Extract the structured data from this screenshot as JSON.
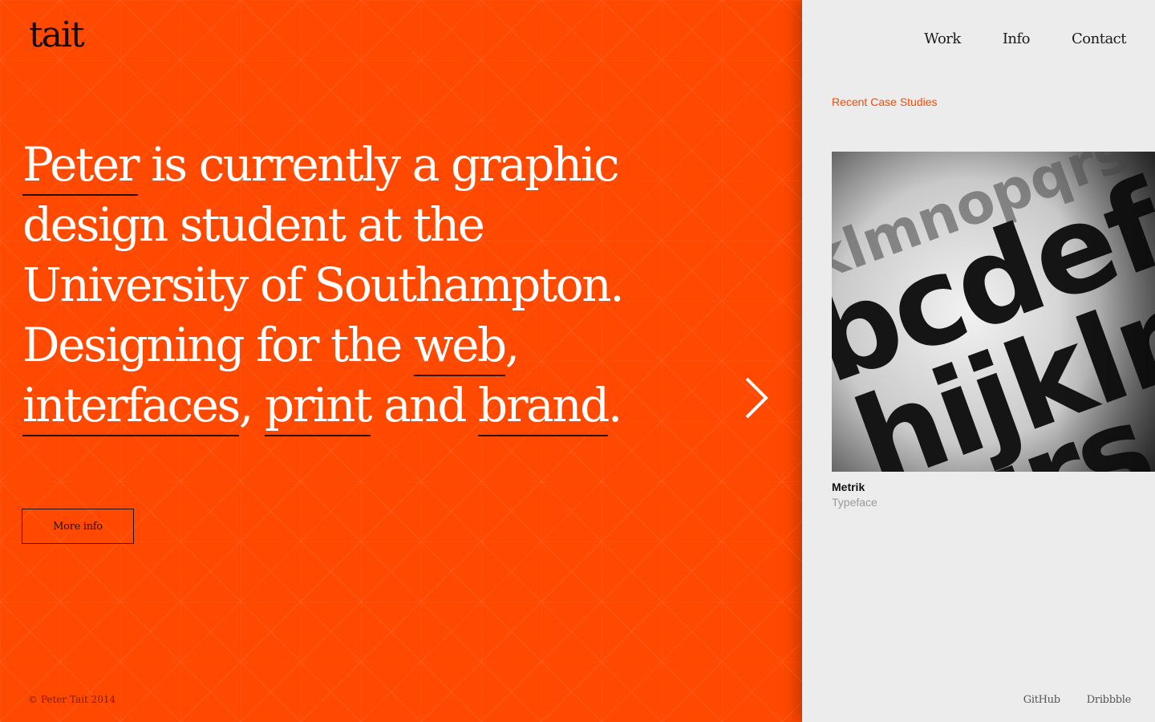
{
  "brand": {
    "logo": "tait"
  },
  "hero": {
    "headline_parts": [
      {
        "text": "Peter",
        "link": true
      },
      {
        "text": " is currently a graphic design student at the University of Southampton. Designing for the ",
        "link": false
      },
      {
        "text": "web",
        "link": true
      },
      {
        "text": ", ",
        "link": false
      },
      {
        "text": "interfaces",
        "link": true
      },
      {
        "text": ", ",
        "link": false
      },
      {
        "text": "print",
        "link": true
      },
      {
        "text": " and ",
        "link": false
      },
      {
        "text": "brand",
        "link": true
      },
      {
        "text": ".",
        "link": false
      }
    ],
    "more_info_label": "More info",
    "next_icon": "chevron-right-icon"
  },
  "footer": {
    "copyright": "© Peter Tait 2014"
  },
  "nav": {
    "items": [
      {
        "label": "Work"
      },
      {
        "label": "Info"
      },
      {
        "label": "Contact"
      }
    ]
  },
  "case_studies": {
    "title": "Recent Case Studies",
    "items": [
      {
        "title": "Metrik",
        "type": "Typeface"
      }
    ]
  },
  "social": {
    "links": [
      {
        "label": "GitHub"
      },
      {
        "label": "Dribbble"
      }
    ]
  },
  "colors": {
    "accent": "#ff4800",
    "side_bg": "#ececec",
    "underline": "#2b0c00"
  }
}
